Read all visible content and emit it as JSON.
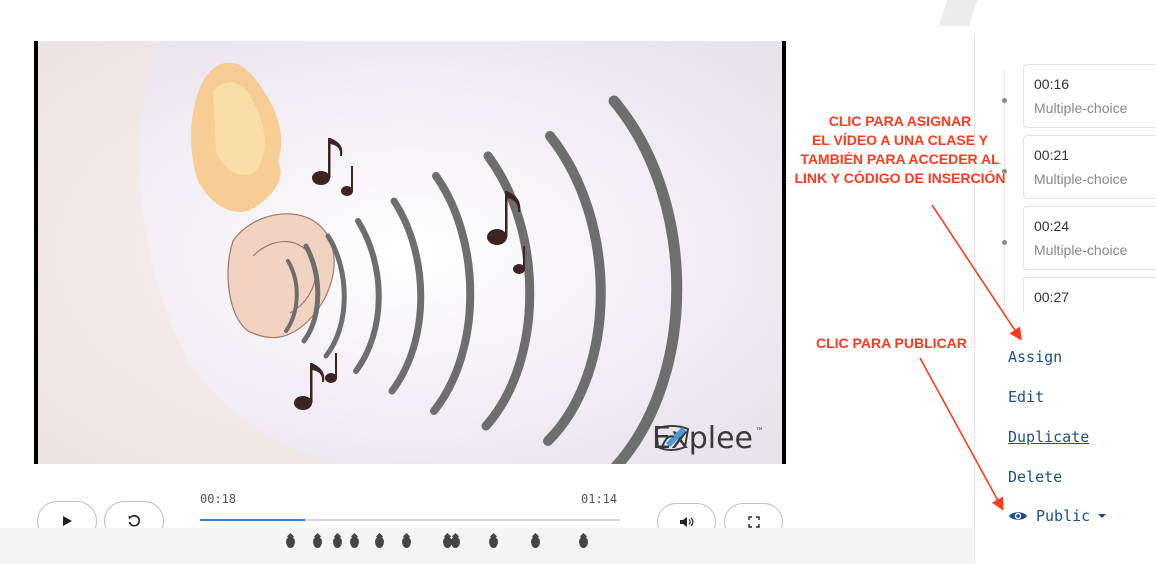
{
  "video": {
    "brand": "Explee",
    "brand_tm": "™"
  },
  "player": {
    "play_icon": "play-icon",
    "replay_icon": "replay-icon",
    "volume_icon": "volume-icon",
    "fullscreen_icon": "fullscreen-icon",
    "current_time": "00:18",
    "duration": "01:14",
    "progress_fraction": 0.25,
    "marker_count": 12
  },
  "timeline": {
    "items": [
      {
        "time": "00:16",
        "type": "Multiple-choice"
      },
      {
        "time": "00:21",
        "type": "Multiple-choice"
      },
      {
        "time": "00:24",
        "type": "Multiple-choice"
      },
      {
        "time": "00:27",
        "type": ""
      }
    ]
  },
  "actions": {
    "assign": "Assign",
    "edit": "Edit",
    "duplicate": "Duplicate",
    "delete": "Delete",
    "visibility": "Public"
  },
  "annotations": {
    "assign_note_lines": [
      "CLIC PARA ASIGNAR",
      "EL VÍDEO A UNA CLASE Y",
      "TAMBIÉN PARA ACCEDER AL",
      "LINK Y CÓDIGO DE INSERCIÓN"
    ],
    "publish_note": "CLIC PARA PUBLICAR"
  },
  "colors": {
    "accent": "#3a7bd5",
    "link": "#1d4f86",
    "annotation": "#ff3a1e"
  }
}
